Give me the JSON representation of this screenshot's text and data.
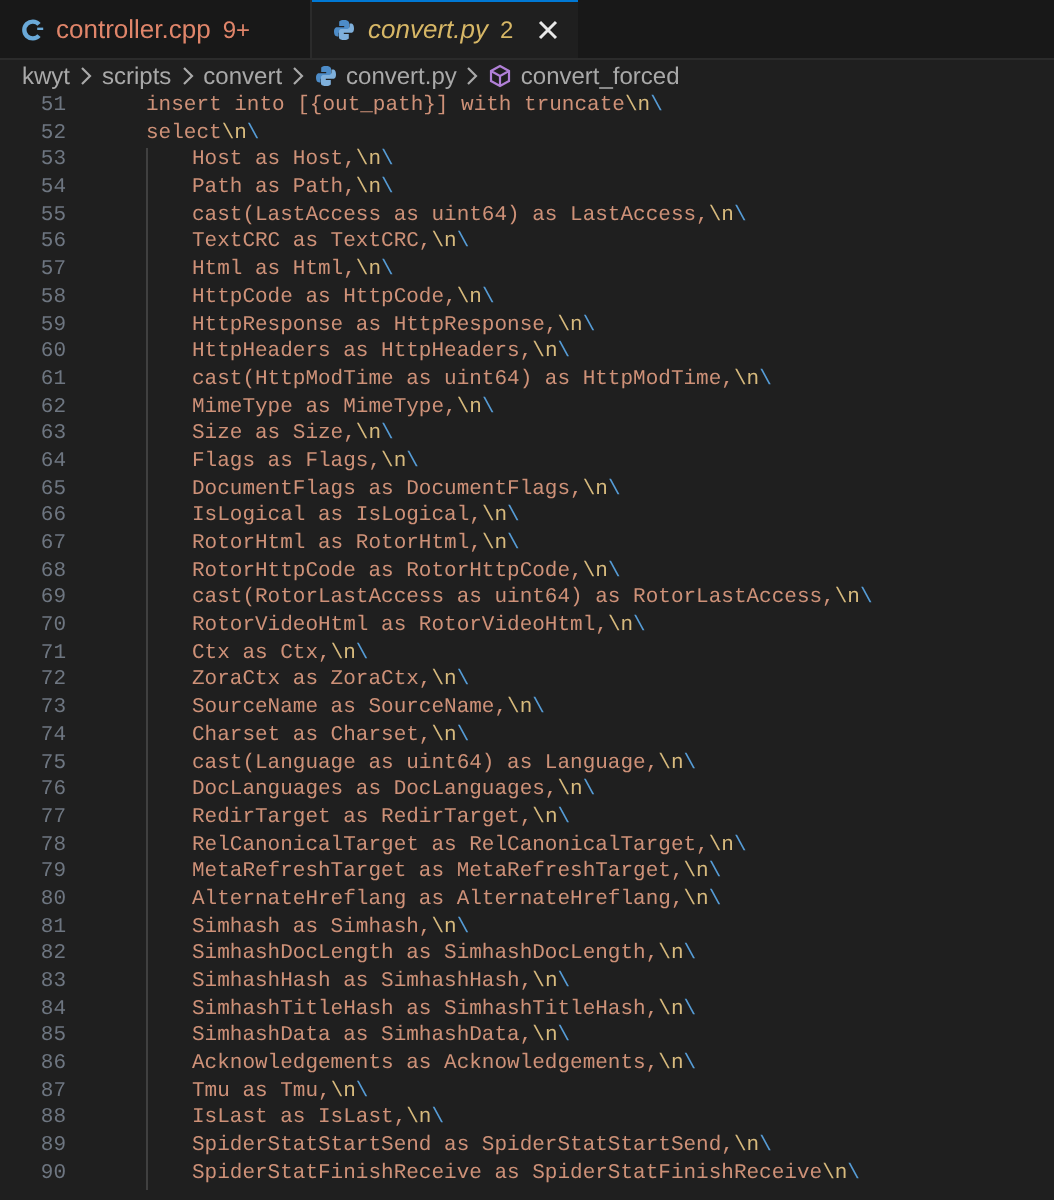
{
  "tabs": [
    {
      "label": "controller.cpp",
      "problems": "9+",
      "color": "#e0856a",
      "kind": "cpp",
      "selected": false,
      "preview": false
    },
    {
      "label": "convert.py",
      "problems": "2",
      "color": "#d7b766",
      "kind": "python",
      "selected": true,
      "preview": true
    }
  ],
  "breadcrumb": [
    {
      "label": "kwyt",
      "kind": "folder"
    },
    {
      "label": "scripts",
      "kind": "folder"
    },
    {
      "label": "convert",
      "kind": "folder"
    },
    {
      "label": "convert.py",
      "kind": "python"
    },
    {
      "label": "convert_forced",
      "kind": "symbol"
    }
  ],
  "lines": [
    {
      "number": "51",
      "text": "insert into [{out_path}] with truncate",
      "escape": "\\n",
      "continuation": "\\"
    },
    {
      "number": "52",
      "text": "select",
      "escape": "\\n",
      "continuation": "\\",
      "children": [
        {
          "number": "53",
          "text": "Host as Host,",
          "escape": "\\n",
          "continuation": "\\"
        },
        {
          "number": "54",
          "text": "Path as Path,",
          "escape": "\\n",
          "continuation": "\\"
        },
        {
          "number": "55",
          "text": "cast(LastAccess as uint64) as LastAccess,",
          "escape": "\\n",
          "continuation": "\\"
        },
        {
          "number": "56",
          "text": "TextCRC as TextCRC,",
          "escape": "\\n",
          "continuation": "\\"
        },
        {
          "number": "57",
          "text": "Html as Html,",
          "escape": "\\n",
          "continuation": "\\"
        },
        {
          "number": "58",
          "text": "HttpCode as HttpCode,",
          "escape": "\\n",
          "continuation": "\\"
        },
        {
          "number": "59",
          "text": "HttpResponse as HttpResponse,",
          "escape": "\\n",
          "continuation": "\\"
        },
        {
          "number": "60",
          "text": "HttpHeaders as HttpHeaders,",
          "escape": "\\n",
          "continuation": "\\"
        },
        {
          "number": "61",
          "text": "cast(HttpModTime as uint64) as HttpModTime,",
          "escape": "\\n",
          "continuation": "\\"
        },
        {
          "number": "62",
          "text": "MimeType as MimeType,",
          "escape": "\\n",
          "continuation": "\\"
        },
        {
          "number": "63",
          "text": "Size as Size,",
          "escape": "\\n",
          "continuation": "\\"
        },
        {
          "number": "64",
          "text": "Flags as Flags,",
          "escape": "\\n",
          "continuation": "\\"
        },
        {
          "number": "65",
          "text": "DocumentFlags as DocumentFlags,",
          "escape": "\\n",
          "continuation": "\\"
        },
        {
          "number": "66",
          "text": "IsLogical as IsLogical,",
          "escape": "\\n",
          "continuation": "\\"
        },
        {
          "number": "67",
          "text": "RotorHtml as RotorHtml,",
          "escape": "\\n",
          "continuation": "\\"
        },
        {
          "number": "68",
          "text": "RotorHttpCode as RotorHttpCode,",
          "escape": "\\n",
          "continuation": "\\"
        },
        {
          "number": "69",
          "text": "cast(RotorLastAccess as uint64) as RotorLastAccess,",
          "escape": "\\n",
          "continuation": "\\"
        },
        {
          "number": "70",
          "text": "RotorVideoHtml as RotorVideoHtml,",
          "escape": "\\n",
          "continuation": "\\"
        },
        {
          "number": "71",
          "text": "Ctx as Ctx,",
          "escape": "\\n",
          "continuation": "\\"
        },
        {
          "number": "72",
          "text": "ZoraCtx as ZoraCtx,",
          "escape": "\\n",
          "continuation": "\\"
        },
        {
          "number": "73",
          "text": "SourceName as SourceName,",
          "escape": "\\n",
          "continuation": "\\"
        },
        {
          "number": "74",
          "text": "Charset as Charset,",
          "escape": "\\n",
          "continuation": "\\"
        },
        {
          "number": "75",
          "text": "cast(Language as uint64) as Language,",
          "escape": "\\n",
          "continuation": "\\"
        },
        {
          "number": "76",
          "text": "DocLanguages as DocLanguages,",
          "escape": "\\n",
          "continuation": "\\"
        },
        {
          "number": "77",
          "text": "RedirTarget as RedirTarget,",
          "escape": "\\n",
          "continuation": "\\"
        },
        {
          "number": "78",
          "text": "RelCanonicalTarget as RelCanonicalTarget,",
          "escape": "\\n",
          "continuation": "\\"
        },
        {
          "number": "79",
          "text": "MetaRefreshTarget as MetaRefreshTarget,",
          "escape": "\\n",
          "continuation": "\\"
        },
        {
          "number": "80",
          "text": "AlternateHreflang as AlternateHreflang,",
          "escape": "\\n",
          "continuation": "\\"
        },
        {
          "number": "81",
          "text": "Simhash as Simhash,",
          "escape": "\\n",
          "continuation": "\\"
        },
        {
          "number": "82",
          "text": "SimhashDocLength as SimhashDocLength,",
          "escape": "\\n",
          "continuation": "\\"
        },
        {
          "number": "83",
          "text": "SimhashHash as SimhashHash,",
          "escape": "\\n",
          "continuation": "\\"
        },
        {
          "number": "84",
          "text": "SimhashTitleHash as SimhashTitleHash,",
          "escape": "\\n",
          "continuation": "\\"
        },
        {
          "number": "85",
          "text": "SimhashData as SimhashData,",
          "escape": "\\n",
          "continuation": "\\"
        },
        {
          "number": "86",
          "text": "Acknowledgements as Acknowledgements,",
          "escape": "\\n",
          "continuation": "\\"
        },
        {
          "number": "87",
          "text": "Tmu as Tmu,",
          "escape": "\\n",
          "continuation": "\\"
        },
        {
          "number": "88",
          "text": "IsLast as IsLast,",
          "escape": "\\n",
          "continuation": "\\"
        },
        {
          "number": "89",
          "text": "SpiderStatStartSend as SpiderStatStartSend,",
          "escape": "\\n",
          "continuation": "\\"
        },
        {
          "number": "90",
          "text": "SpiderStatFinishReceive as SpiderStatFinishReceive",
          "escape": "\\n",
          "continuation": "\\"
        }
      ]
    }
  ]
}
